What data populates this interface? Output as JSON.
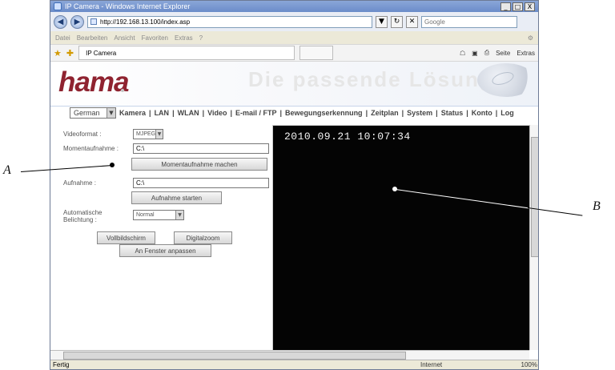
{
  "window": {
    "title": "IP Camera - Windows Internet Explorer",
    "controls": {
      "minimize": "_",
      "maximize": "□",
      "close": "X"
    }
  },
  "address_bar": {
    "back": "◀",
    "forward": "▶",
    "url": "http://192.168.13.100/index.asp",
    "dropdown": "▼",
    "refresh": "↻",
    "stop": "✕",
    "search_placeholder": "Google"
  },
  "menu": {
    "items": [
      "Datei",
      "Bearbeiten",
      "Ansicht",
      "Favoriten",
      "Extras",
      "?"
    ],
    "tools_icon": "⚙"
  },
  "tabs": {
    "active": "IP Camera",
    "command_bar": [
      "☖",
      "▣",
      "⎙",
      "Seite",
      "Extras"
    ]
  },
  "page": {
    "logo": "hama",
    "slogan": "Die passende Lösung",
    "language": "German",
    "nav": [
      "Kamera",
      "LAN",
      "WLAN",
      "Video",
      "E-mail / FTP",
      "Bewegungserkennung",
      "Zeitplan",
      "System",
      "Status",
      "Konto",
      "Log"
    ],
    "form": {
      "videoformat_label": "Videoformat :",
      "videoformat_value": "MJPEG",
      "snapshot_label": "Momentaufnahme :",
      "snapshot_value": "C:\\",
      "snapshot_button": "Momentaufnahme machen",
      "recording_label": "Aufnahme :",
      "recording_value": "C:\\",
      "recording_button": "Aufnahme starten",
      "exposure_label": "Automatische\nBelichtung :",
      "exposure_value": "Normal",
      "fullscreen_button": "Vollbildschirm",
      "zoom_button": "Digitalzoom",
      "fit_button": "An Fenster anpassen"
    },
    "video_timestamp": "2010.09.21 10:07:34"
  },
  "statusbar": {
    "text": "Fertig",
    "zone": "Internet",
    "zoom": "100%"
  },
  "annotations": {
    "left": "A",
    "right": "B"
  }
}
